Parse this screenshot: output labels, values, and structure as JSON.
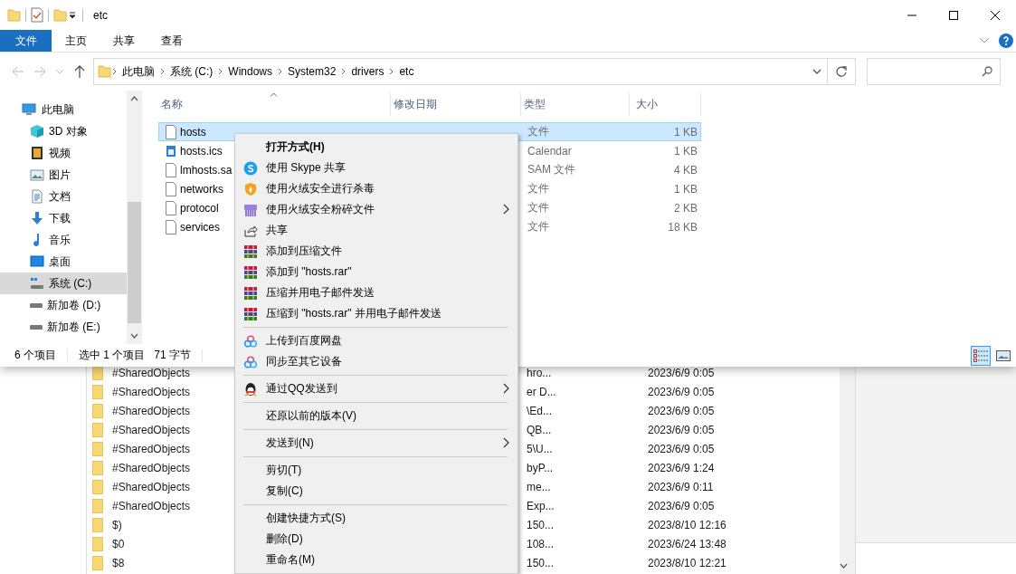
{
  "window": {
    "title": "etc"
  },
  "ribbon": {
    "tabs": [
      {
        "label": "文件",
        "kind": "file"
      },
      {
        "label": "主页",
        "kind": "tab"
      },
      {
        "label": "共享",
        "kind": "tab"
      },
      {
        "label": "查看",
        "kind": "tab"
      }
    ]
  },
  "address_bar": {
    "breadcrumbs": [
      "此电脑",
      "系统 (C:)",
      "Windows",
      "System32",
      "drivers",
      "etc"
    ]
  },
  "navigation_pane": {
    "items": [
      {
        "label": "此电脑",
        "kind": "computer",
        "selected": false,
        "children": [
          {
            "label": "3D 对象",
            "kind": "cube",
            "selected": false
          },
          {
            "label": "视频",
            "kind": "film",
            "selected": false
          },
          {
            "label": "图片",
            "kind": "picture",
            "selected": false
          },
          {
            "label": "文档",
            "kind": "document",
            "selected": false
          },
          {
            "label": "下载",
            "kind": "download",
            "selected": false
          },
          {
            "label": "音乐",
            "kind": "music",
            "selected": false
          },
          {
            "label": "桌面",
            "kind": "desktop",
            "selected": false
          },
          {
            "label": "系统 (C:)",
            "kind": "systemdrive",
            "selected": true
          },
          {
            "label": "新加卷 (D:)",
            "kind": "drive",
            "selected": false
          },
          {
            "label": "新加卷 (E:)",
            "kind": "drive",
            "selected": false
          }
        ]
      }
    ]
  },
  "file_list": {
    "columns": [
      {
        "label": "名称",
        "sorted": true
      },
      {
        "label": "修改日期",
        "sorted": false
      },
      {
        "label": "类型",
        "sorted": false
      },
      {
        "label": "大小",
        "sorted": false
      }
    ],
    "rows": [
      {
        "name": "hosts",
        "kind": "file",
        "type": "文件",
        "size": "1 KB",
        "selected": true
      },
      {
        "name": "hosts.ics",
        "kind": "calendar",
        "type": "Calendar",
        "size": "1 KB",
        "selected": false
      },
      {
        "name": "lmhosts.sa",
        "kind": "file",
        "type": "SAM 文件",
        "size": "4 KB",
        "selected": false
      },
      {
        "name": "networks",
        "kind": "file",
        "type": "文件",
        "size": "1 KB",
        "selected": false
      },
      {
        "name": "protocol",
        "kind": "file",
        "type": "文件",
        "size": "2 KB",
        "selected": false
      },
      {
        "name": "services",
        "kind": "file",
        "type": "文件",
        "size": "18 KB",
        "selected": false
      }
    ]
  },
  "status_bar": {
    "item_count": "6 个项目",
    "selection": "选中 1 个项目",
    "selection_size": "71 字节",
    "view_buttons": [
      {
        "kind": "details",
        "selected": true
      },
      {
        "kind": "thumbnails",
        "selected": false
      }
    ]
  },
  "background_window": {
    "rows": [
      {
        "name": "#SharedObjects",
        "column_2": "hro...",
        "date": "2023/6/9 0:05"
      },
      {
        "name": "#SharedObjects",
        "column_2": "er D...",
        "date": "2023/6/9 0:05"
      },
      {
        "name": "#SharedObjects",
        "column_2": "\\Ed...",
        "date": "2023/6/9 0:05"
      },
      {
        "name": "#SharedObjects",
        "column_2": "QB...",
        "date": "2023/6/9 0:05"
      },
      {
        "name": "#SharedObjects",
        "column_2": "5\\U...",
        "date": "2023/6/9 0:05"
      },
      {
        "name": "#SharedObjects",
        "column_2": "byP...",
        "date": "2023/6/9 1:24"
      },
      {
        "name": "#SharedObjects",
        "column_2": "me...",
        "date": "2023/6/9 0:11"
      },
      {
        "name": "#SharedObjects",
        "column_2": "Exp...",
        "date": "2023/6/9 0:05"
      },
      {
        "name": "$)",
        "column_2": "150...",
        "date": "2023/8/10 12:16"
      },
      {
        "name": "$0",
        "column_2": "108...",
        "date": "2023/6/24 13:48"
      },
      {
        "name": "$8",
        "column_2": "150...",
        "date": "2023/8/10 12:21"
      }
    ]
  },
  "context_menu": {
    "items": [
      {
        "kind": "text",
        "label": "打开方式(H)",
        "bold": true,
        "submenu": false
      },
      {
        "kind": "skype",
        "label": "使用 Skype 共享",
        "bold": false,
        "submenu": false
      },
      {
        "kind": "shield",
        "label": "使用火绒安全进行杀毒",
        "bold": false,
        "submenu": false
      },
      {
        "kind": "shredder",
        "label": "使用火绒安全粉碎文件",
        "bold": false,
        "submenu": true
      },
      {
        "kind": "share",
        "label": "共享",
        "bold": false,
        "submenu": false
      },
      {
        "kind": "archive",
        "label": "添加到压缩文件",
        "bold": false,
        "submenu": false
      },
      {
        "kind": "archive",
        "label": "添加到 \"hosts.rar\"",
        "bold": false,
        "submenu": false
      },
      {
        "kind": "archive",
        "label": "压缩并用电子邮件发送",
        "bold": false,
        "submenu": false
      },
      {
        "kind": "archive",
        "label": "压缩到 \"hosts.rar\" 并用电子邮件发送",
        "bold": false,
        "submenu": false
      },
      {
        "kind": "separator"
      },
      {
        "kind": "cloud",
        "label": "上传到百度网盘",
        "bold": false,
        "submenu": false
      },
      {
        "kind": "cloud",
        "label": "同步至其它设备",
        "bold": false,
        "submenu": false
      },
      {
        "kind": "separator"
      },
      {
        "kind": "penguin",
        "label": "通过QQ发送到",
        "bold": false,
        "submenu": true
      },
      {
        "kind": "separator"
      },
      {
        "kind": "text",
        "label": "还原以前的版本(V)",
        "bold": false,
        "submenu": false
      },
      {
        "kind": "separator"
      },
      {
        "kind": "text",
        "label": "发送到(N)",
        "bold": false,
        "submenu": true
      },
      {
        "kind": "separator"
      },
      {
        "kind": "text",
        "label": "剪切(T)",
        "bold": false,
        "submenu": false
      },
      {
        "kind": "text",
        "label": "复制(C)",
        "bold": false,
        "submenu": false
      },
      {
        "kind": "separator"
      },
      {
        "kind": "text",
        "label": "创建快捷方式(S)",
        "bold": false,
        "submenu": false
      },
      {
        "kind": "text",
        "label": "删除(D)",
        "bold": false,
        "submenu": false
      },
      {
        "kind": "text",
        "label": "重命名(M)",
        "bold": false,
        "submenu": false
      }
    ]
  }
}
